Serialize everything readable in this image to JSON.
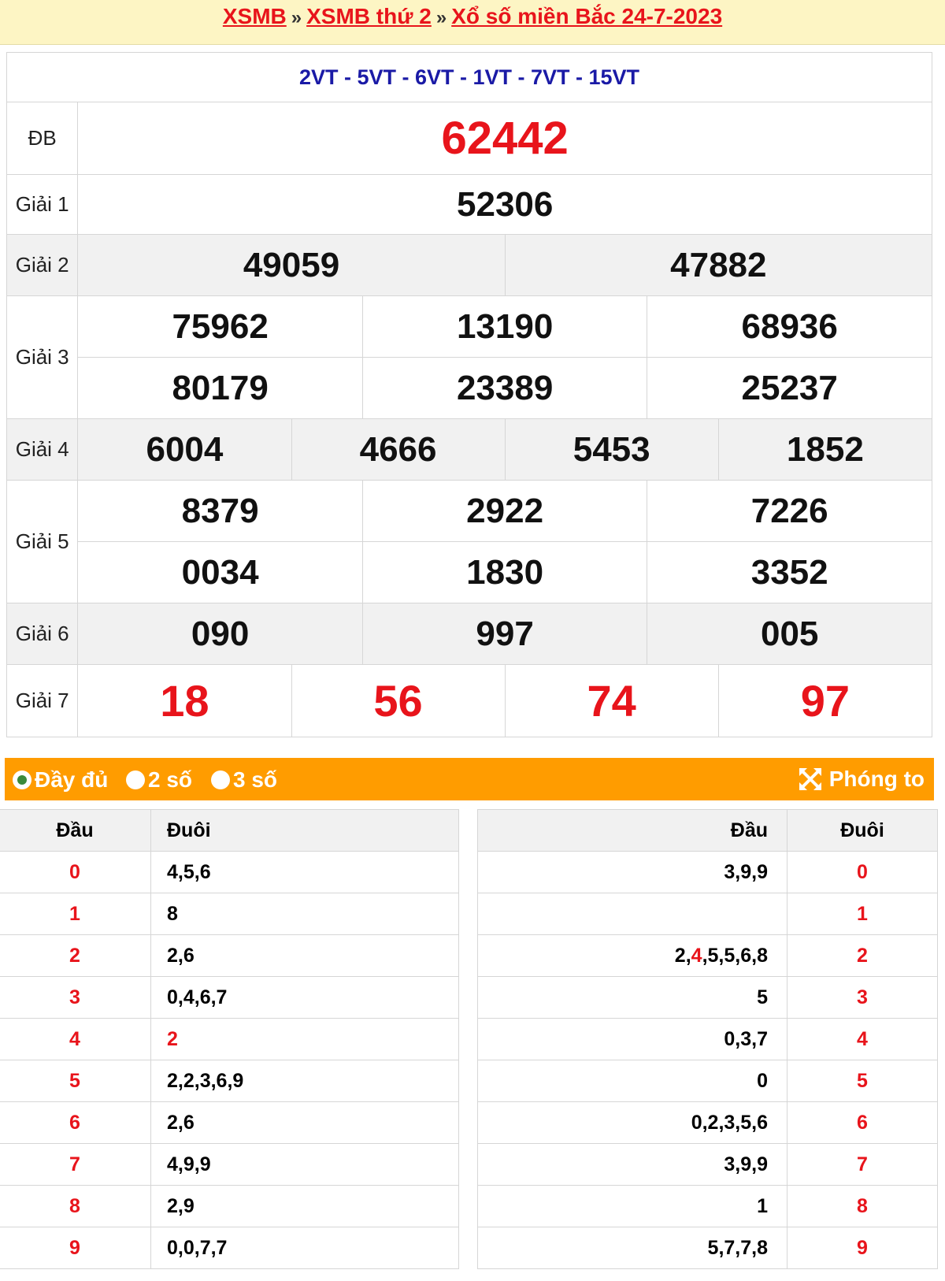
{
  "breadcrumb": {
    "home": "XSMB",
    "sep": "»",
    "day": "XSMB thứ 2",
    "current": "Xổ số miền Bắc 24-7-2023"
  },
  "results": {
    "codes": "2VT - 5VT - 6VT - 1VT - 7VT - 15VT",
    "labels": {
      "db": "ĐB",
      "g1": "Giải 1",
      "g2": "Giải 2",
      "g3": "Giải 3",
      "g4": "Giải 4",
      "g5": "Giải 5",
      "g6": "Giải 6",
      "g7": "Giải 7"
    },
    "db": "62442",
    "g1": "52306",
    "g2": [
      "49059",
      "47882"
    ],
    "g3": [
      "75962",
      "13190",
      "68936",
      "80179",
      "23389",
      "25237"
    ],
    "g4": [
      "6004",
      "4666",
      "5453",
      "1852"
    ],
    "g5": [
      "8379",
      "2922",
      "7226",
      "0034",
      "1830",
      "3352"
    ],
    "g6": [
      "090",
      "997",
      "005"
    ],
    "g7": [
      "18",
      "56",
      "74",
      "97"
    ]
  },
  "options": {
    "full": "Đầy đủ",
    "two": "2 số",
    "three": "3 số",
    "selected": "full",
    "zoom": "Phóng to"
  },
  "loto": {
    "col_dau": "Đầu",
    "col_duoi": "Đuôi",
    "left": [
      [
        "0",
        "4,5,6"
      ],
      [
        "1",
        "8"
      ],
      [
        "2",
        "2,6"
      ],
      [
        "3",
        "0,4,6,7"
      ],
      [
        "4",
        "2"
      ],
      [
        "5",
        "2,2,3,6,9"
      ],
      [
        "6",
        "2,6"
      ],
      [
        "7",
        "4,9,9"
      ],
      [
        "8",
        "2,9"
      ],
      [
        "9",
        "0,0,7,7"
      ]
    ],
    "right": [
      [
        "3,9,9",
        "0"
      ],
      [
        "",
        "1"
      ],
      [
        "2,4,5,5,6,8",
        "2"
      ],
      [
        "5",
        "3"
      ],
      [
        "0,3,7",
        "4"
      ],
      [
        "0",
        "5"
      ],
      [
        "0,2,3,5,6",
        "6"
      ],
      [
        "3,9,9",
        "7"
      ],
      [
        "1",
        "8"
      ],
      [
        "5,7,7,8",
        "9"
      ]
    ]
  },
  "colors": {
    "red": "#e8141b",
    "blue": "#1a1aa6",
    "orange": "#ff9c00",
    "yellow": "#fdf5c4"
  }
}
